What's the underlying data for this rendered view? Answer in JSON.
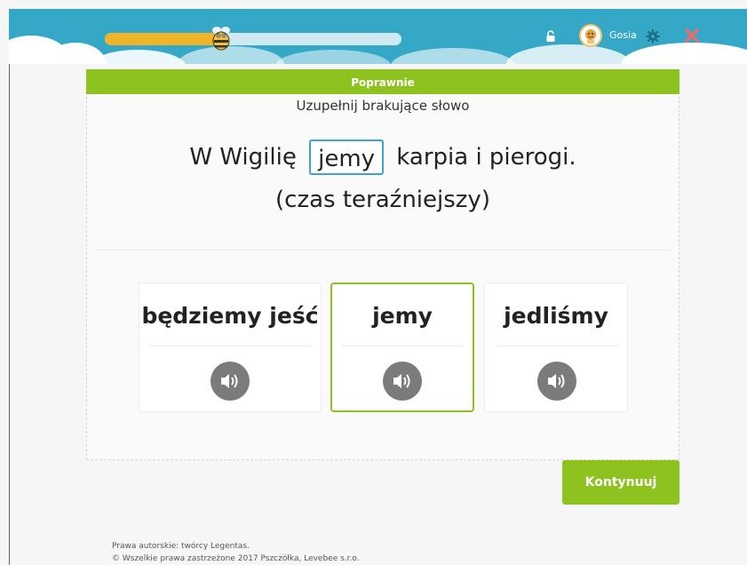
{
  "colors": {
    "header_bg": "#35a8c8",
    "accent_green": "#8dc21f",
    "progress_fill": "#f0b429",
    "gap_border": "#3aa7c6",
    "audio_button": "#7b7b7b",
    "close_icon": "#f06b6b"
  },
  "header": {
    "progress_value": 0.38,
    "user_name": "Gosia",
    "icons": [
      "bee-icon",
      "lock-icon",
      "avatar-icon",
      "gear-icon",
      "close-icon"
    ]
  },
  "exercise": {
    "status": "Poprawnie",
    "instruction": "Uzupełnij brakujące słowo",
    "sentence_before": "W Wigilię",
    "answer": "jemy",
    "sentence_after": "karpia i pierogi.",
    "tense_hint": "(czas teraźniejszy)"
  },
  "options": [
    {
      "label": "będziemy jeść",
      "selected": false
    },
    {
      "label": "jemy",
      "selected": true
    },
    {
      "label": "jedliśmy",
      "selected": false
    }
  ],
  "continue_label": "Kontynuuj",
  "footer": {
    "line1": "Prawa autorskie: twórcy Legentas.",
    "line2": "© Wszelkie prawa zastrzeżone 2017 Pszczółka, Levebee s.r.o."
  }
}
